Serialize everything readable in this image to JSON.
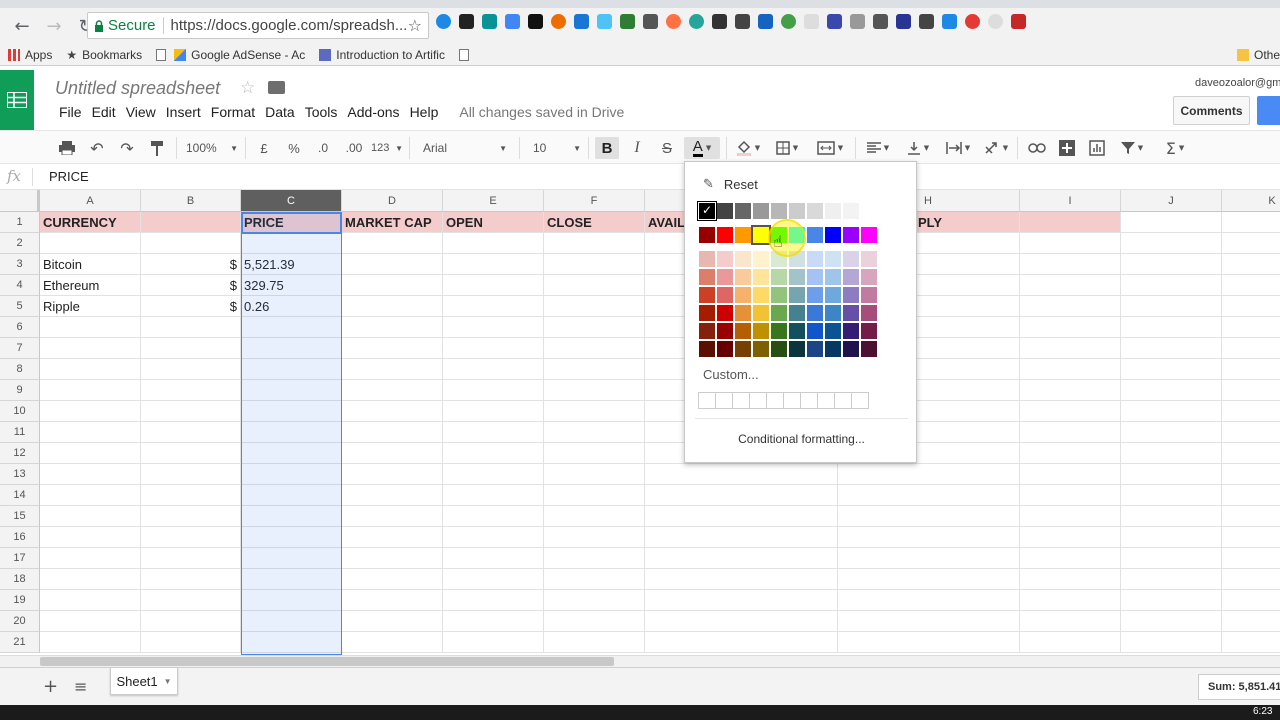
{
  "browser": {
    "secure_label": "Secure",
    "url": "https://docs.google.com/spreadsh...",
    "bookmarks": [
      "Apps",
      "Bookmarks",
      "Google AdSense - Ac",
      "Introduction to Artific"
    ],
    "other_bookmarks": "Othe"
  },
  "doc": {
    "title": "Untitled spreadsheet",
    "menus": [
      "File",
      "Edit",
      "View",
      "Insert",
      "Format",
      "Data",
      "Tools",
      "Add-ons",
      "Help"
    ],
    "save_status": "All changes saved in Drive",
    "user_email": "daveozoalor@gm",
    "comments_label": "Comments"
  },
  "toolbar": {
    "zoom": "100%",
    "currency": "£",
    "percent": "%",
    "dec_decrease": ".0",
    "dec_increase": ".00",
    "more_formats": "123",
    "font": "Arial",
    "font_size": "10",
    "bold": "B",
    "italic": "I",
    "strike": "S",
    "text_color": "A"
  },
  "formula_bar": {
    "fx": "fx",
    "value": "PRICE"
  },
  "grid": {
    "columns": [
      "A",
      "B",
      "C",
      "D",
      "E",
      "F",
      "G",
      "H",
      "I",
      "J",
      "K"
    ],
    "rows": [
      "1",
      "2",
      "3",
      "4",
      "5",
      "6",
      "7",
      "8",
      "9",
      "10",
      "11",
      "12",
      "13",
      "14",
      "15",
      "16",
      "17",
      "18",
      "19",
      "20",
      "21"
    ],
    "header_row": [
      "CURRENCY",
      "",
      "PRICE",
      "MARKET CAP",
      "OPEN",
      "CLOSE",
      "AVAIL",
      "PLY",
      ""
    ],
    "data": [
      {
        "name": "Bitcoin",
        "sym": "$",
        "price": "5,521.39"
      },
      {
        "name": "Ethereum",
        "sym": "$",
        "price": "329.75"
      },
      {
        "name": "Ripple",
        "sym": "$",
        "price": "0.26"
      }
    ]
  },
  "color_popup": {
    "reset_label": "Reset",
    "custom_label": "Custom...",
    "conditional_label": "Conditional formatting...",
    "grays": [
      "#000000",
      "#434343",
      "#666666",
      "#999999",
      "#b7b7b7",
      "#cccccc",
      "#d9d9d9",
      "#efefef",
      "#f3f3f3",
      "#ffffff"
    ],
    "brights": [
      "#980000",
      "#ff0000",
      "#ff9900",
      "#ffff00",
      "#00ff00",
      "#00ffff",
      "#4a86e8",
      "#0000ff",
      "#9900ff",
      "#ff00ff"
    ],
    "shades": [
      [
        "#e6b8af",
        "#f4cccc",
        "#fce5cd",
        "#fff2cc",
        "#d9ead3",
        "#d0e0e3",
        "#c9daf8",
        "#cfe2f3",
        "#d9d2e9",
        "#ead1dc"
      ],
      [
        "#dd7e6b",
        "#ea9999",
        "#f9cb9c",
        "#ffe599",
        "#b6d7a8",
        "#a2c4c9",
        "#a4c2f4",
        "#9fc5e8",
        "#b4a7d6",
        "#d5a6bd"
      ],
      [
        "#cc4125",
        "#e06666",
        "#f6b26b",
        "#ffd966",
        "#93c47d",
        "#76a5af",
        "#6d9eeb",
        "#6fa8dc",
        "#8e7cc3",
        "#c27ba0"
      ],
      [
        "#a61c00",
        "#cc0000",
        "#e69138",
        "#f1c232",
        "#6aa84f",
        "#45818e",
        "#3c78d8",
        "#3d85c6",
        "#674ea7",
        "#a64d79"
      ],
      [
        "#85200c",
        "#990000",
        "#b45f06",
        "#bf9000",
        "#38761d",
        "#134f5c",
        "#1155cc",
        "#0b5394",
        "#351c75",
        "#741b47"
      ],
      [
        "#5b0f00",
        "#660000",
        "#783f04",
        "#7f6000",
        "#274e13",
        "#0c343d",
        "#1c4587",
        "#073763",
        "#20124d",
        "#4c1130"
      ]
    ]
  },
  "sheets": {
    "tab": "Sheet1",
    "sum": "Sum: 5,851.41"
  },
  "taskbar": {
    "time": "6:23"
  },
  "colors": {
    "sheets_green": "#0f9d58",
    "header_fill": "#f4cccc",
    "selection_blue": "#4a86e8"
  }
}
